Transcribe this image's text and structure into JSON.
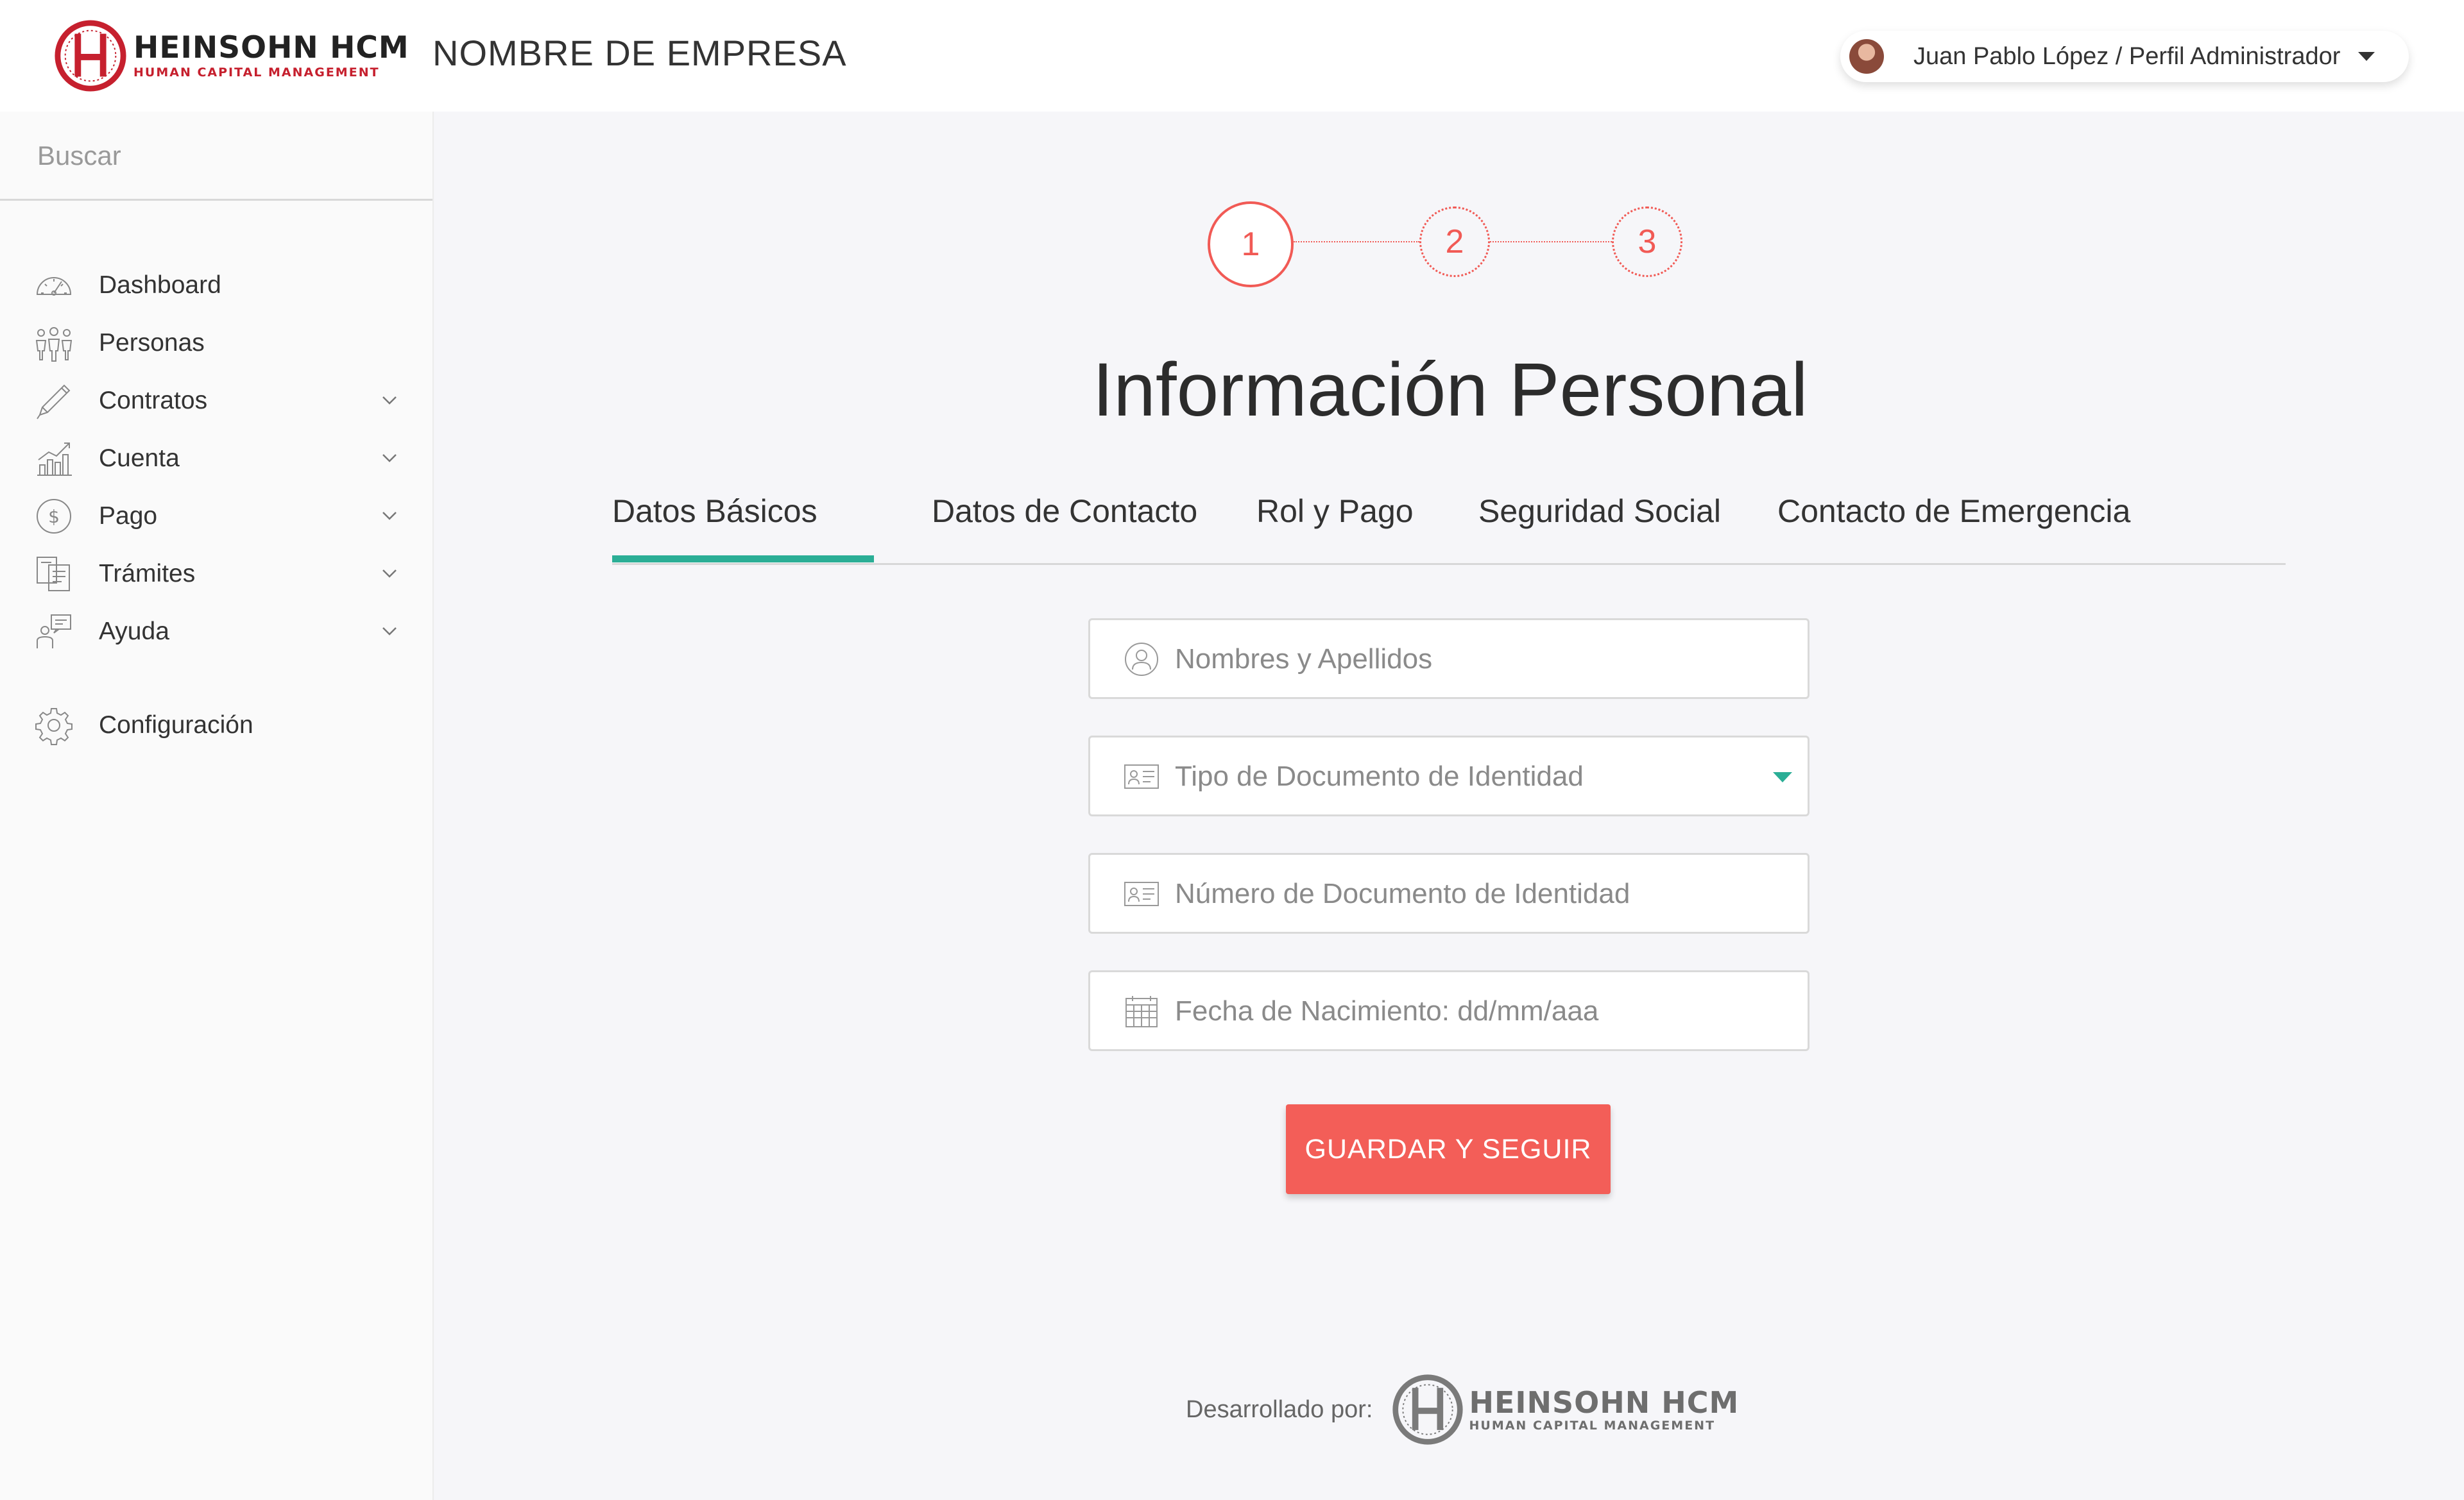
{
  "brand": {
    "logo_title": "HEINSOHN HCM",
    "logo_subtitle": "HUMAN CAPITAL MANAGEMENT",
    "logo_icon": "heinsohn-h-logo",
    "accent_color": "#c6202e"
  },
  "header": {
    "company_name": "NOMBRE DE EMPRESA",
    "user_label": "Juan Pablo López / Perfil Administrador"
  },
  "sidebar": {
    "search_placeholder": "Buscar",
    "items": [
      {
        "label": "Dashboard",
        "icon": "speedometer-icon",
        "has_submenu": false
      },
      {
        "label": "Personas",
        "icon": "people-icon",
        "has_submenu": false
      },
      {
        "label": "Contratos",
        "icon": "pencil-icon",
        "has_submenu": true
      },
      {
        "label": "Cuenta",
        "icon": "bar-chart-icon",
        "has_submenu": true
      },
      {
        "label": "Pago",
        "icon": "dollar-coin-icon",
        "has_submenu": true
      },
      {
        "label": "Trámites",
        "icon": "documents-icon",
        "has_submenu": true
      },
      {
        "label": "Ayuda",
        "icon": "help-person-icon",
        "has_submenu": true
      }
    ],
    "config_label": "Configuración",
    "config_icon": "gear-icon"
  },
  "stepper": {
    "steps": [
      "1",
      "2",
      "3"
    ],
    "current": 1,
    "color": "#f15a55"
  },
  "main": {
    "title": "Información Personal",
    "tabs": [
      {
        "label": "Datos Básicos",
        "active": true
      },
      {
        "label": "Datos de Contacto",
        "active": false
      },
      {
        "label": "Rol y Pago",
        "active": false
      },
      {
        "label": "Seguridad Social",
        "active": false
      },
      {
        "label": "Contacto de Emergencia",
        "active": false
      }
    ],
    "tab_accent_color": "#2bae96",
    "form": {
      "names_placeholder": "Nombres y Apellidos",
      "doc_type_placeholder": "Tipo de Documento de Identidad",
      "doc_number_placeholder": "Número de Documento de Identidad",
      "birthdate_placeholder": "Fecha de Nacimiento: dd/mm/aaa"
    },
    "save_label": "GUARDAR Y SEGUIR",
    "save_color": "#f35e58"
  },
  "footer": {
    "developed_by": "Desarrollado por:",
    "logo_title": "HEINSOHN HCM",
    "logo_subtitle": "HUMAN CAPITAL MANAGEMENT"
  }
}
